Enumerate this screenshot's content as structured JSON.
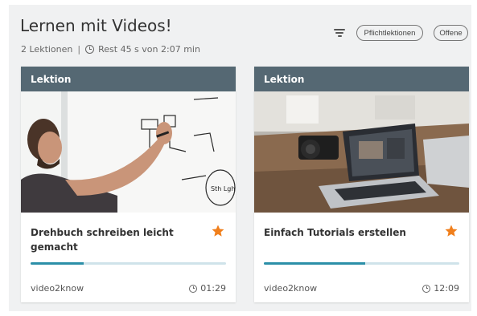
{
  "header": {
    "title": "Lernen mit Videos!",
    "lessons": "2 Lektionen",
    "separator": "|",
    "remaining": "Rest 45 s von 2:07 min"
  },
  "filters": {
    "icon": "filter-icon",
    "required_label": "Pflichtlektionen",
    "open_label": "Offene"
  },
  "cards": [
    {
      "header": "Lektion",
      "title": "Drehbuch schreiben leicht gemacht",
      "provider": "video2know",
      "duration": "01:29",
      "progress": 0.27,
      "starred": true,
      "image": "man-writing-on-whiteboard"
    },
    {
      "header": "Lektion",
      "title": "Einfach Tutorials erstellen",
      "provider": "video2know",
      "duration": "12:09",
      "progress": 0.52,
      "starred": true,
      "image": "laptop-with-camera-on-desk"
    }
  ],
  "colors": {
    "card_header": "#556873",
    "progress_fill": "#2b8fa8",
    "progress_track": "#cfe3ea",
    "star": "#f07f1c",
    "panel_bg": "#f0f1f2"
  }
}
